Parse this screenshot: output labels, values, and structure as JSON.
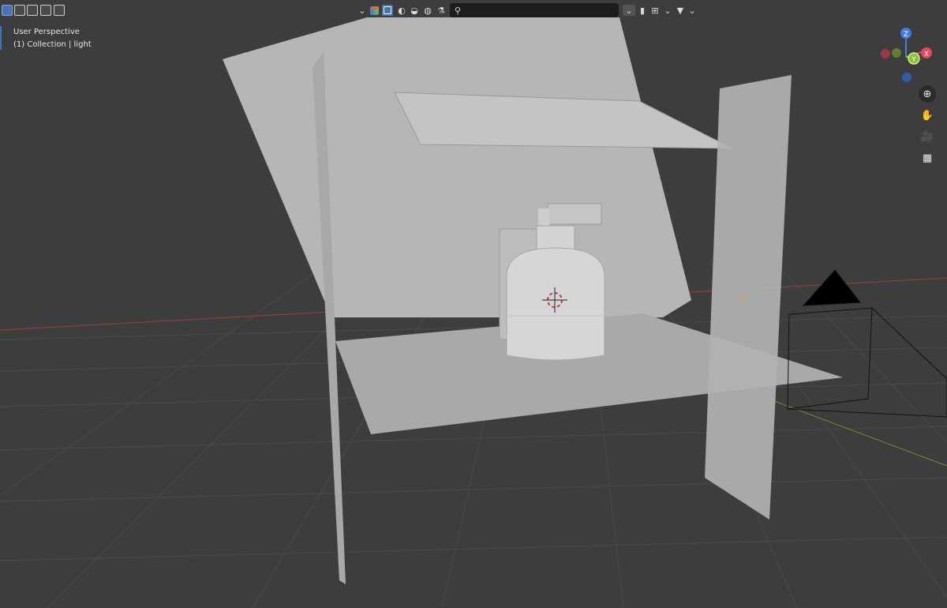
{
  "viewport": {
    "view_name": "User Perspective",
    "collection_label": "(1) Collection | light"
  },
  "header": {
    "select_modes": [
      "select-box",
      "extend",
      "subtract",
      "invert",
      "intersect"
    ],
    "shading_modes": [
      "wireframe",
      "solid",
      "material-preview",
      "rendered"
    ],
    "search_placeholder": ""
  },
  "gizmo": {
    "axes": {
      "x": "X",
      "y": "Y",
      "z": "Z"
    },
    "colors": {
      "x": "#e04a5a",
      "y": "#8ac13a",
      "z": "#3f7ee0"
    }
  },
  "nav_tools": [
    "zoom-icon",
    "pan-hand-icon",
    "camera-view-icon",
    "ortho-grid-icon"
  ],
  "colors": {
    "background": "#3d3d3d",
    "grid": "#4a4a4a",
    "x_axis": "#a33b3b",
    "y_axis": "#7a8a2a",
    "panel": "#b4b4b4",
    "select_accent": "#4772b3"
  }
}
